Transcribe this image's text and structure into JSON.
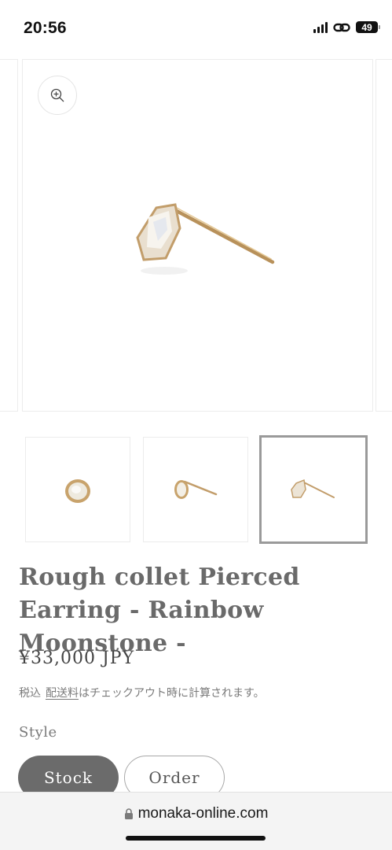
{
  "status_bar": {
    "time": "20:56",
    "battery": "49",
    "icons": [
      "signal-icon",
      "link-icon",
      "battery-icon"
    ]
  },
  "gallery": {
    "zoom_icon": "zoom-in-icon",
    "thumbnails": [
      "earring-front-view",
      "earring-angled-view",
      "earring-side-view"
    ],
    "selected_index": 2
  },
  "product": {
    "title": "Rough collet Pierced Earring - Rainbow Moonstone -",
    "price": "¥33,000 JPY",
    "tax_prefix": "税込",
    "shipping_link": "配送料",
    "tax_suffix": "はチェックアウト時に計算されます。",
    "option_label": "Style",
    "options": [
      "Stock",
      "Order"
    ],
    "selected_option": "Stock"
  },
  "browser": {
    "url": "monaka-online.com",
    "lock_icon": "lock-icon"
  },
  "colors": {
    "selected_pill": "#6b6b6b",
    "text_muted": "#7a7a7a",
    "gold": "#c9a46c"
  }
}
